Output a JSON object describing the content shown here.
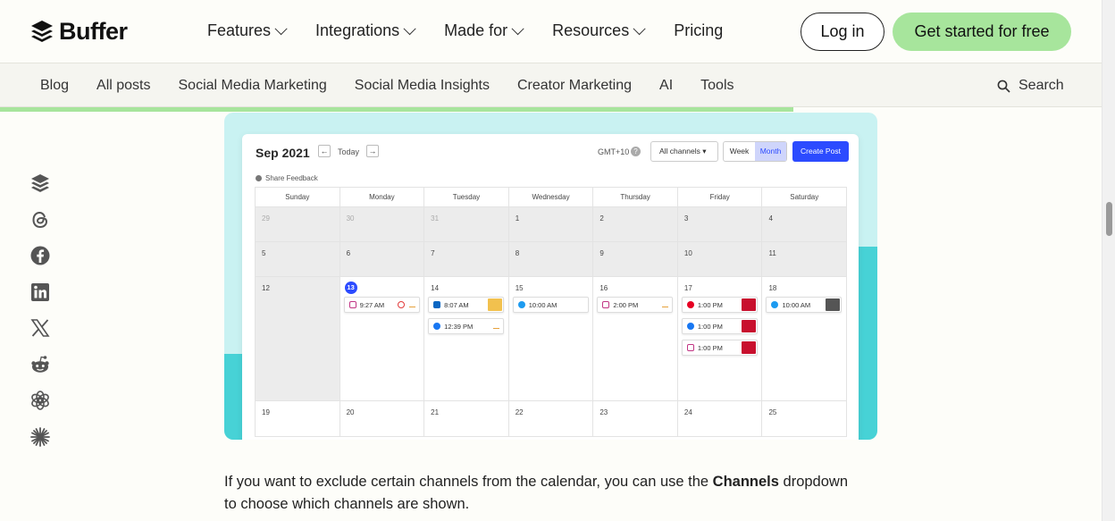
{
  "brand": {
    "name": "Buffer",
    "accent": "#a7e59c",
    "cta_blue": "#2c4bff"
  },
  "nav": {
    "items": [
      {
        "label": "Features",
        "has_dropdown": true
      },
      {
        "label": "Integrations",
        "has_dropdown": true
      },
      {
        "label": "Made for",
        "has_dropdown": true
      },
      {
        "label": "Resources",
        "has_dropdown": true
      },
      {
        "label": "Pricing",
        "has_dropdown": false
      }
    ],
    "login": "Log in",
    "cta": "Get started for free"
  },
  "subnav": {
    "items": [
      "Blog",
      "All posts",
      "Social Media Marketing",
      "Social Media Insights",
      "Creator Marketing",
      "AI",
      "Tools"
    ],
    "search": "Search"
  },
  "reading_progress": 0.72,
  "share_icons": [
    "buffer-icon",
    "threads-icon",
    "facebook-icon",
    "linkedin-icon",
    "x-icon",
    "reddit-icon",
    "openai-icon",
    "perplexity-icon"
  ],
  "calendar": {
    "month": "Sep 2021",
    "today_label": "Today",
    "timezone": "GMT+10",
    "channels_label": "All channels",
    "view_week": "Week",
    "view_month": "Month",
    "create_label": "Create Post",
    "feedback_label": "Share Feedback",
    "weekdays": [
      "Sunday",
      "Monday",
      "Tuesday",
      "Wednesday",
      "Thursday",
      "Friday",
      "Saturday"
    ],
    "rows": [
      [
        "29",
        "30",
        "31",
        "1",
        "2",
        "3",
        "4"
      ],
      [
        "5",
        "6",
        "7",
        "8",
        "9",
        "10",
        "11"
      ],
      [
        "12",
        "13",
        "14",
        "15",
        "16",
        "17",
        "18"
      ],
      [
        "19",
        "20",
        "21",
        "22",
        "23",
        "24",
        "25"
      ]
    ],
    "posts": {
      "mon": [
        {
          "time": "9:27 AM",
          "network": "instagram"
        }
      ],
      "tue": [
        {
          "time": "8:07 AM",
          "network": "linkedin"
        },
        {
          "time": "12:39 PM",
          "network": "facebook"
        }
      ],
      "wed": [
        {
          "time": "10:00 AM",
          "network": "twitter"
        }
      ],
      "thu": [
        {
          "time": "2:00 PM",
          "network": "instagram"
        }
      ],
      "fri": [
        {
          "time": "1:00 PM",
          "network": "pinterest"
        },
        {
          "time": "1:00 PM",
          "network": "facebook"
        },
        {
          "time": "1:00 PM",
          "network": "instagram"
        }
      ],
      "sat": [
        {
          "time": "10:00 AM",
          "network": "twitter"
        }
      ]
    }
  },
  "body": {
    "before": "If you want to exclude certain channels from the calendar, you can use the ",
    "bold": "Channels",
    "after": " dropdown to choose which channels are shown."
  }
}
